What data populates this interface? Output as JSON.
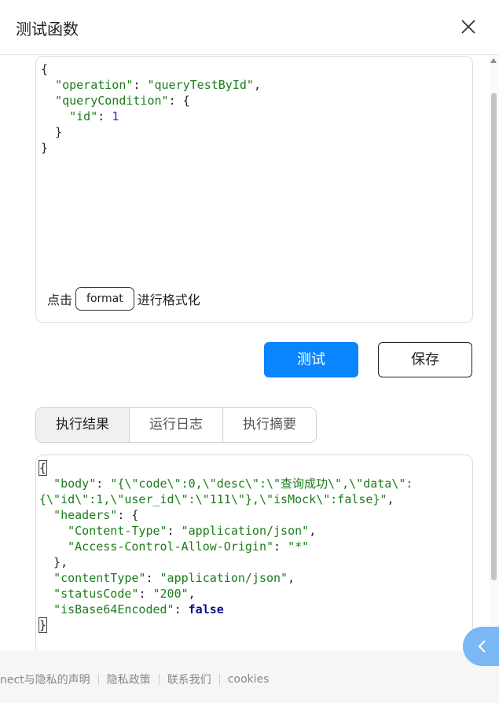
{
  "dialog": {
    "title": "测试函数",
    "close_icon": "close-icon"
  },
  "editor": {
    "lines": [
      [
        {
          "t": "p",
          "v": "{"
        }
      ],
      [
        {
          "t": "p",
          "v": "  "
        },
        {
          "t": "k",
          "v": "\"operation\""
        },
        {
          "t": "p",
          "v": ": "
        },
        {
          "t": "s",
          "v": "\"queryTestById\""
        },
        {
          "t": "p",
          "v": ","
        }
      ],
      [
        {
          "t": "p",
          "v": "  "
        },
        {
          "t": "k",
          "v": "\"queryCondition\""
        },
        {
          "t": "p",
          "v": ": {"
        }
      ],
      [
        {
          "t": "p",
          "v": "    "
        },
        {
          "t": "k",
          "v": "\"id\""
        },
        {
          "t": "p",
          "v": ": "
        },
        {
          "t": "n",
          "v": "1"
        }
      ],
      [
        {
          "t": "p",
          "v": "  }"
        }
      ],
      [
        {
          "t": "p",
          "v": "}"
        }
      ]
    ],
    "format_prefix": "点击",
    "format_button": "format",
    "format_suffix": "进行格式化"
  },
  "actions": {
    "test_label": "测试",
    "save_label": "保存"
  },
  "tabs": [
    {
      "label": "执行结果",
      "active": true
    },
    {
      "label": "运行日志",
      "active": false
    },
    {
      "label": "执行摘要",
      "active": false
    }
  ],
  "result": {
    "lines": [
      [
        {
          "t": "box",
          "v": "{"
        }
      ],
      [
        {
          "t": "p",
          "v": "  "
        },
        {
          "t": "k",
          "v": "\"body\""
        },
        {
          "t": "p",
          "v": ": "
        },
        {
          "t": "s",
          "v": "\"{\\\"code\\\":0,\\\"desc\\\":\\\"查询成功\\\",\\\"data\\\":"
        }
      ],
      [
        {
          "t": "s",
          "v": "{\\\"id\\\":1,\\\"user_id\\\":\\\"111\\\"},\\\"isMock\\\":false}\""
        },
        {
          "t": "p",
          "v": ","
        }
      ],
      [
        {
          "t": "p",
          "v": "  "
        },
        {
          "t": "k",
          "v": "\"headers\""
        },
        {
          "t": "p",
          "v": ": {"
        }
      ],
      [
        {
          "t": "p",
          "v": "    "
        },
        {
          "t": "k",
          "v": "\"Content-Type\""
        },
        {
          "t": "p",
          "v": ": "
        },
        {
          "t": "s",
          "v": "\"application/json\""
        },
        {
          "t": "p",
          "v": ","
        }
      ],
      [
        {
          "t": "p",
          "v": "    "
        },
        {
          "t": "k",
          "v": "\"Access-Control-Allow-Origin\""
        },
        {
          "t": "p",
          "v": ": "
        },
        {
          "t": "s",
          "v": "\"*\""
        }
      ],
      [
        {
          "t": "p",
          "v": "  },"
        }
      ],
      [
        {
          "t": "p",
          "v": "  "
        },
        {
          "t": "k",
          "v": "\"contentType\""
        },
        {
          "t": "p",
          "v": ": "
        },
        {
          "t": "s",
          "v": "\"application/json\""
        },
        {
          "t": "p",
          "v": ","
        }
      ],
      [
        {
          "t": "p",
          "v": "  "
        },
        {
          "t": "k",
          "v": "\"statusCode\""
        },
        {
          "t": "p",
          "v": ": "
        },
        {
          "t": "s",
          "v": "\"200\""
        },
        {
          "t": "p",
          "v": ","
        }
      ],
      [
        {
          "t": "p",
          "v": "  "
        },
        {
          "t": "k",
          "v": "\"isBase64Encoded\""
        },
        {
          "t": "p",
          "v": ": "
        },
        {
          "t": "b",
          "v": "false"
        }
      ],
      [
        {
          "t": "box",
          "v": "}"
        }
      ]
    ]
  },
  "footer": {
    "links": [
      "nect与隐私的声明",
      "隐私政策",
      "联系我们",
      "cookies"
    ]
  },
  "float_button": {
    "icon": "chevron-left-icon"
  },
  "colors": {
    "primary": "#0a84ff",
    "json_key": "#1a7d1a",
    "json_number": "#1a33cc",
    "json_boolean": "#0b0b8f"
  }
}
